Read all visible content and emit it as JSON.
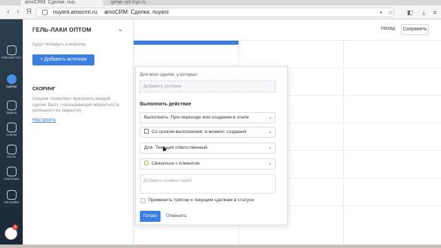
{
  "browser": {
    "tabs": [
      "amoCRM: Сделки, nuy...",
      "gelak-opt.mpr.ru"
    ],
    "url": "nuyeni.amocrm.ru",
    "page_title": "amoCRM: Сделки, nuyeni"
  },
  "leftbar": {
    "items": [
      {
        "label": "Рабочий стол",
        "icon": "dashboard-icon"
      },
      {
        "label": "Сделки",
        "icon": "deals-icon"
      },
      {
        "label": "Задачи",
        "icon": "tasks-icon"
      },
      {
        "label": "Списки",
        "icon": "lists-icon"
      },
      {
        "label": "Почта",
        "icon": "mail-icon"
      },
      {
        "label": "Аналитика",
        "icon": "analytics-icon"
      },
      {
        "label": "Настройки",
        "icon": "settings-icon"
      }
    ],
    "chat_badge": "2"
  },
  "settings_panel": {
    "title": "ГЕЛЬ-ЛАКИ ОПТОМ",
    "source_text": "будут попадать в воронку",
    "add_source": "+ Добавить источник",
    "scoring_title": "СКОРИНГ",
    "scoring_text": "Скоринг позволяет присвоить каждой сделке балл, показывающий вероятность успешного ее закрытия",
    "setup_link": "Настроить"
  },
  "topbar": {
    "back": "Назад",
    "save": "Сохранить"
  },
  "popup": {
    "for_all_label": "Для всех сделок, у которых:",
    "add_condition": "Добавить условие",
    "action_head": "Выполнить действие",
    "execute": "Выполнить: При переходе или создании в этапе",
    "deadline": "Со сроком выполнения: в момент создания",
    "for_whom": "Для: Текущий ответственный",
    "task_type": "Связаться с клиентом",
    "comment_placeholder": "Добавьте комментарий",
    "apply_label": "Применить триггер к текущим сделкам в статусе",
    "done": "Готово",
    "cancel": "Отменить"
  }
}
